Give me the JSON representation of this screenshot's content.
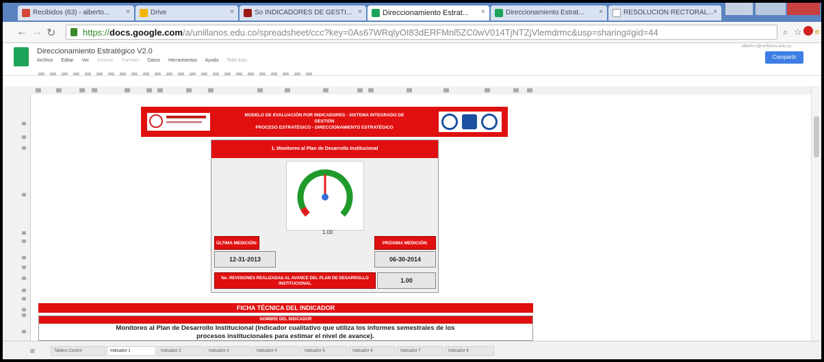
{
  "browser": {
    "tabs": [
      {
        "label": "Recibidos (63) - alberto...",
        "favicon_color": "#d44638",
        "active": false
      },
      {
        "label": "Drive",
        "favicon_color": "#f4b400",
        "active": false
      },
      {
        "label": "So INDICADORES DE GESTI...",
        "favicon_color": "#9a1a1a",
        "active": false
      },
      {
        "label": "Direccionamiento Estrat...",
        "favicon_color": "#1ea45a",
        "active": true
      },
      {
        "label": "Direccionamiento Estrat...",
        "favicon_color": "#1ea45a",
        "active": false
      },
      {
        "label": "RESOLUCION RECTORAL...",
        "favicon_color": "#ffffff",
        "active": false
      }
    ],
    "url_scheme": "https://",
    "url_host": "docs.google.com",
    "url_rest": "/a/unillanos.edu.co/spreadsheet/ccc?key=0As67WRqlyOI83dERFMnl5ZC0wV014TjNTZjVlemdrmc&usp=sharing#gid=44"
  },
  "docs": {
    "title": "Direccionamiento Estratégico V2.0",
    "menu": [
      "Archivo",
      "Editar",
      "Ver",
      "Insertar",
      "Formato",
      "Datos",
      "Herramientas",
      "Ayuda",
      "Todo listo"
    ],
    "share_label": "Compartir",
    "user_email": "alberto.x@unillanos.edu.co"
  },
  "dashboard": {
    "banner_lines": [
      "MODELO DE EVALUACIÓN POR INDICADORES - SISTEMA INTEGRADO DE",
      "GESTIÓN",
      "PROCESO ESTRATÉGICO - DIRECCIONAMIENTO ESTRATÉGICO"
    ],
    "panel_title": "1. Monitoreo al Plan de Desarrollo Institucional",
    "gauge_value": 1.0,
    "gauge_label": "1.00",
    "ultima_label": "ÚLTIMA MEDICIÓN:",
    "ultima_value": "12-31-2013",
    "proxima_label": "PRÓXIMA MEDICIÓN:",
    "proxima_value": "06-30-2014",
    "revisiones_label": "No. REVISIONES REALIZADAS AL AVANCE DEL PLAN DE DESARROLLO INSTITUCIONAL",
    "revisiones_value": "1.00",
    "ficha_title": "FICHA TÉCNICA DEL INDICADOR",
    "nombre_header": "NOMBRE DEL INDICADOR",
    "nombre_text": "Monitoreo al Plan de Desarrollo Institucional (Indicador cualitativo que utiliza los informes semestrales de los procesos institucionales para estimar el nivel de avance)."
  },
  "sheet_tabs": [
    "Tablero Control",
    "Indicador 1",
    "Indicador 2",
    "Indicador 3",
    "Indicador 4",
    "Indicador 5",
    "Indicador 6",
    "Indicador 7",
    "Indicador 8"
  ],
  "colors": {
    "accent_red": "#e01010",
    "gauge_green": "#1f9a2a",
    "needle_red": "#e02020",
    "needle_blue": "#3a6fd8"
  }
}
